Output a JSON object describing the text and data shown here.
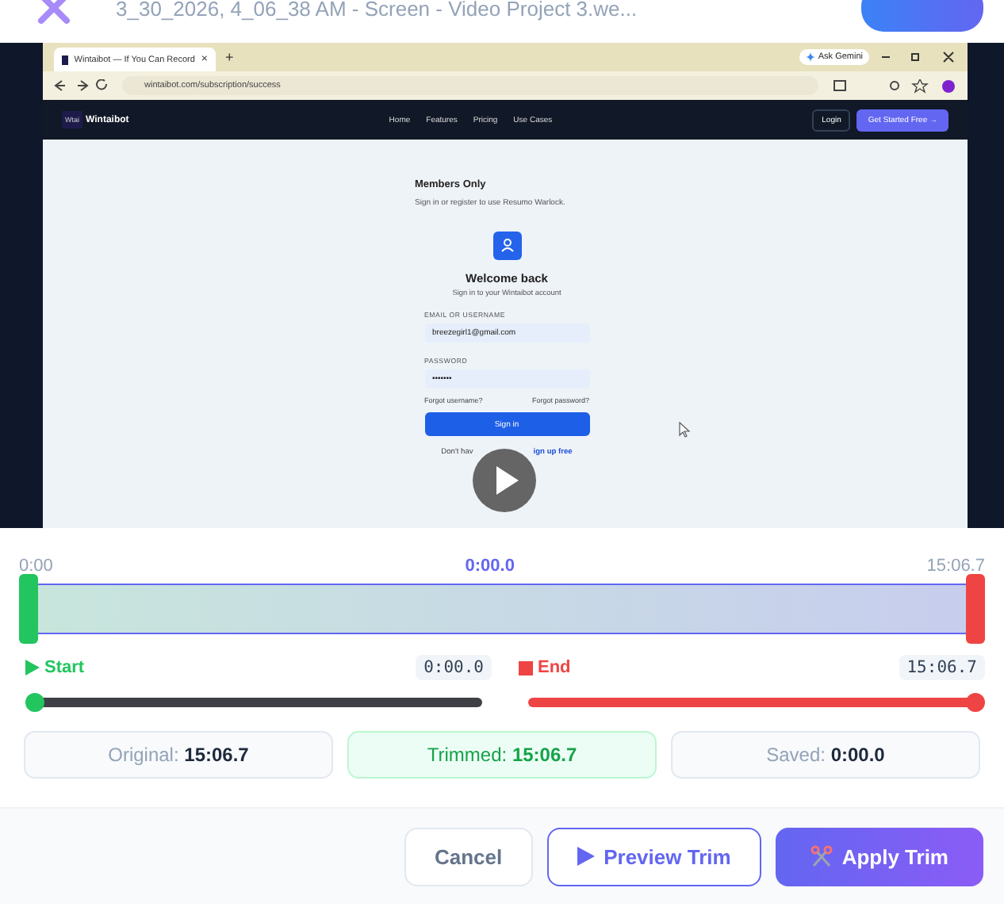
{
  "header": {
    "filename": "3_30_2026, 4_06_38 AM - Screen - Video Project 3.we..."
  },
  "video": {
    "browser": {
      "tab_title": "Wintaibot — If You Can Record",
      "tab_close": "×",
      "new_tab": "+",
      "ask_gemini": "Ask Gemini",
      "url": "wintaibot.com/subscription/success"
    },
    "site": {
      "logo_mark": "Wtai",
      "brand": "Wintaibot",
      "nav": [
        "Home",
        "Features",
        "Pricing",
        "Use Cases"
      ],
      "login": "Login",
      "cta": "Get Started Free →"
    },
    "page": {
      "heading": "Members Only",
      "subheading": "Sign in or register to use Resumo Warlock.",
      "title": "Welcome back",
      "subtitle": "Sign in to your Wintaibot account",
      "email_label": "EMAIL OR USERNAME",
      "email_value": "breezegirl1@gmail.com",
      "password_label": "PASSWORD",
      "password_value": "•••••••",
      "forgot_username": "Forgot username?",
      "forgot_password": "Forgot password?",
      "sign_in": "Sign in",
      "signup_prefix": "Don't hav",
      "signup_link": "ign up free"
    }
  },
  "trimmer": {
    "start_time": "0:00",
    "current_time": "0:00.0",
    "end_time": "15:06.7",
    "start_handle": {
      "level": 0
    },
    "end_handle": {
      "level": 1
    },
    "start": {
      "label": "Start",
      "value": "0:00.0",
      "level": 0
    },
    "end": {
      "label": "End",
      "value": "15:06.7",
      "level": 1
    },
    "stats": [
      {
        "label": "Original:",
        "value": "15:06.7",
        "selected": false
      },
      {
        "label": "Trimmed:",
        "value": "15:06.7",
        "selected": true
      },
      {
        "label": "Saved:",
        "value": "0:00.0",
        "selected": false
      }
    ]
  },
  "buttons": [
    {
      "kind": "cancel",
      "label": "Cancel"
    },
    {
      "kind": "preview",
      "label": "Preview Trim"
    },
    {
      "kind": "apply",
      "label": "Apply Trim"
    }
  ]
}
